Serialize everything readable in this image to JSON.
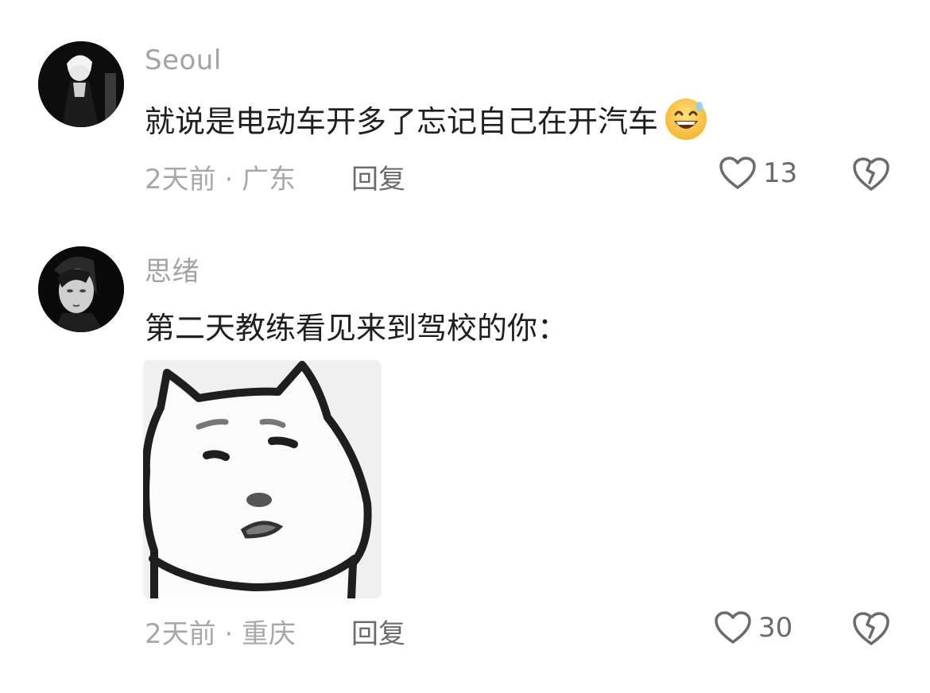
{
  "comments": [
    {
      "username": "Seoul",
      "text": "就说是电动车开多了忘记自己在开汽车",
      "emoji": "grinning-sweat-emoji",
      "time_location": "2天前 · 广东",
      "reply_label": "回复",
      "likes": "13"
    },
    {
      "username": "思绪",
      "text": "第二天教练看见来到驾校的你：",
      "sticker": "cat-meme-sticker",
      "time_location": "2天前 · 重庆",
      "reply_label": "回复",
      "likes": "30"
    }
  ],
  "icons": {
    "like": "heart-outline-icon",
    "dislike": "broken-heart-icon"
  },
  "colors": {
    "username": "#a3a3a3",
    "text": "#1f1f1f",
    "meta": "#a8a8a8",
    "action": "#6b6b6b"
  }
}
